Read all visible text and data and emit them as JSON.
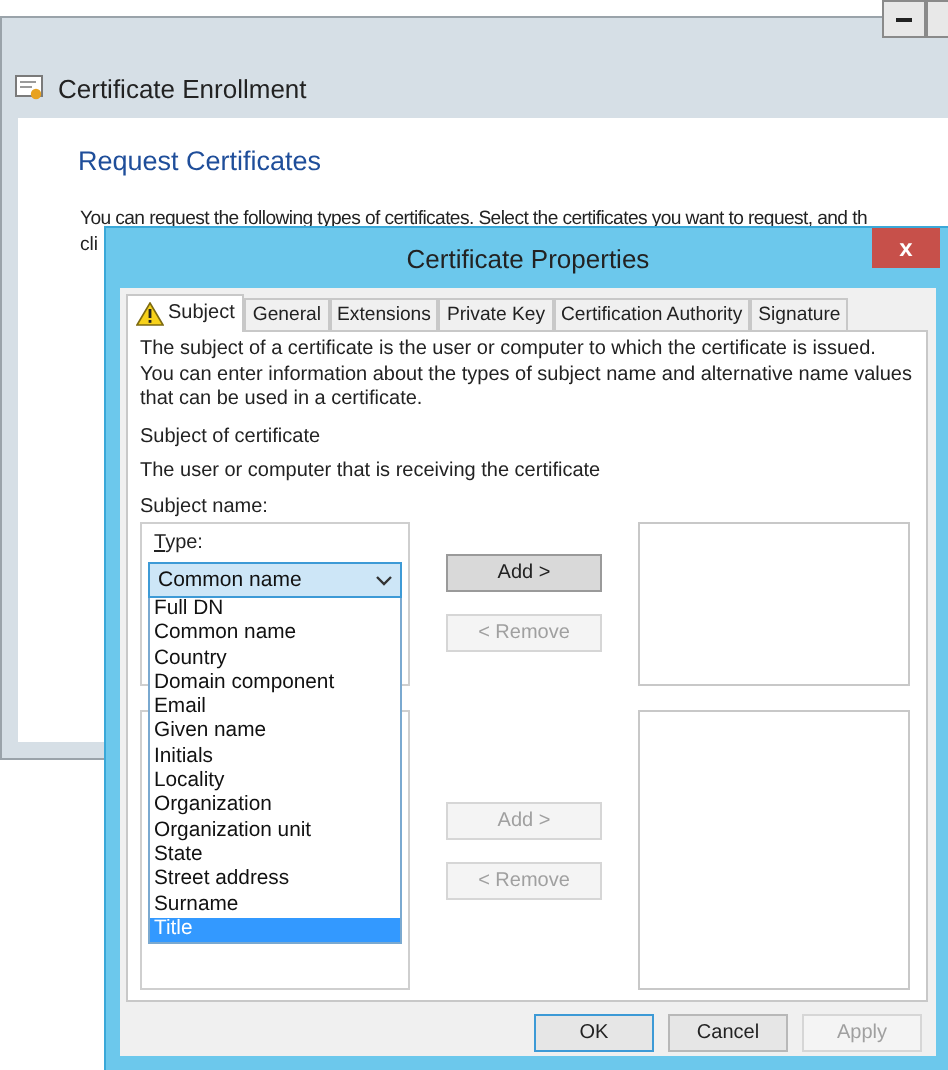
{
  "background_window": {
    "title": "Certificate Enrollment",
    "heading": "Request Certificates",
    "description": "You can request the following types of certificates. Select the certificates you want to request, and th",
    "description_continued": "cli"
  },
  "dialog": {
    "title": "Certificate Properties",
    "close_button": "x",
    "tabs": [
      {
        "label": "Subject",
        "selected": true,
        "warning": true
      },
      {
        "label": "General",
        "selected": false,
        "warning": false
      },
      {
        "label": "Extensions",
        "selected": false,
        "warning": false
      },
      {
        "label": "Private Key",
        "selected": false,
        "warning": false
      },
      {
        "label": "Certification Authority",
        "selected": false,
        "warning": false
      },
      {
        "label": "Signature",
        "selected": false,
        "warning": false
      }
    ],
    "intro": "The subject of a certificate is the user or computer to which the certificate is issued. You can enter information about the types of subject name and alternative name values that can be used in a certificate.",
    "subject_heading": "Subject of certificate",
    "subject_description": "The user or computer that is receiving the certificate",
    "subject_name_label": "Subject name:",
    "type_label": "Type:",
    "type_value": "Common name",
    "type_options": [
      {
        "label": "Full DN",
        "selected": false
      },
      {
        "label": "Common name",
        "selected": false
      },
      {
        "label": "Country",
        "selected": false
      },
      {
        "label": "Domain component",
        "selected": false
      },
      {
        "label": "Email",
        "selected": false
      },
      {
        "label": "Given name",
        "selected": false
      },
      {
        "label": "Initials",
        "selected": false
      },
      {
        "label": "Locality",
        "selected": false
      },
      {
        "label": "Organization",
        "selected": false
      },
      {
        "label": "Organization unit",
        "selected": false
      },
      {
        "label": "State",
        "selected": false
      },
      {
        "label": "Street address",
        "selected": false
      },
      {
        "label": "Surname",
        "selected": false
      },
      {
        "label": "Title",
        "selected": true
      }
    ],
    "subject_buttons": [
      {
        "label": "Add >",
        "disabled": false,
        "focused": true
      },
      {
        "label": "< Remove",
        "disabled": true,
        "focused": false
      }
    ],
    "alternative_buttons": [
      {
        "label": "Add >",
        "disabled": true,
        "focused": false
      },
      {
        "label": "< Remove",
        "disabled": true,
        "focused": false
      }
    ],
    "footer_buttons": [
      {
        "label": "OK",
        "disabled": false,
        "default": true
      },
      {
        "label": "Cancel",
        "disabled": false,
        "default": false
      },
      {
        "label": "Apply",
        "disabled": true,
        "default": false
      }
    ]
  }
}
